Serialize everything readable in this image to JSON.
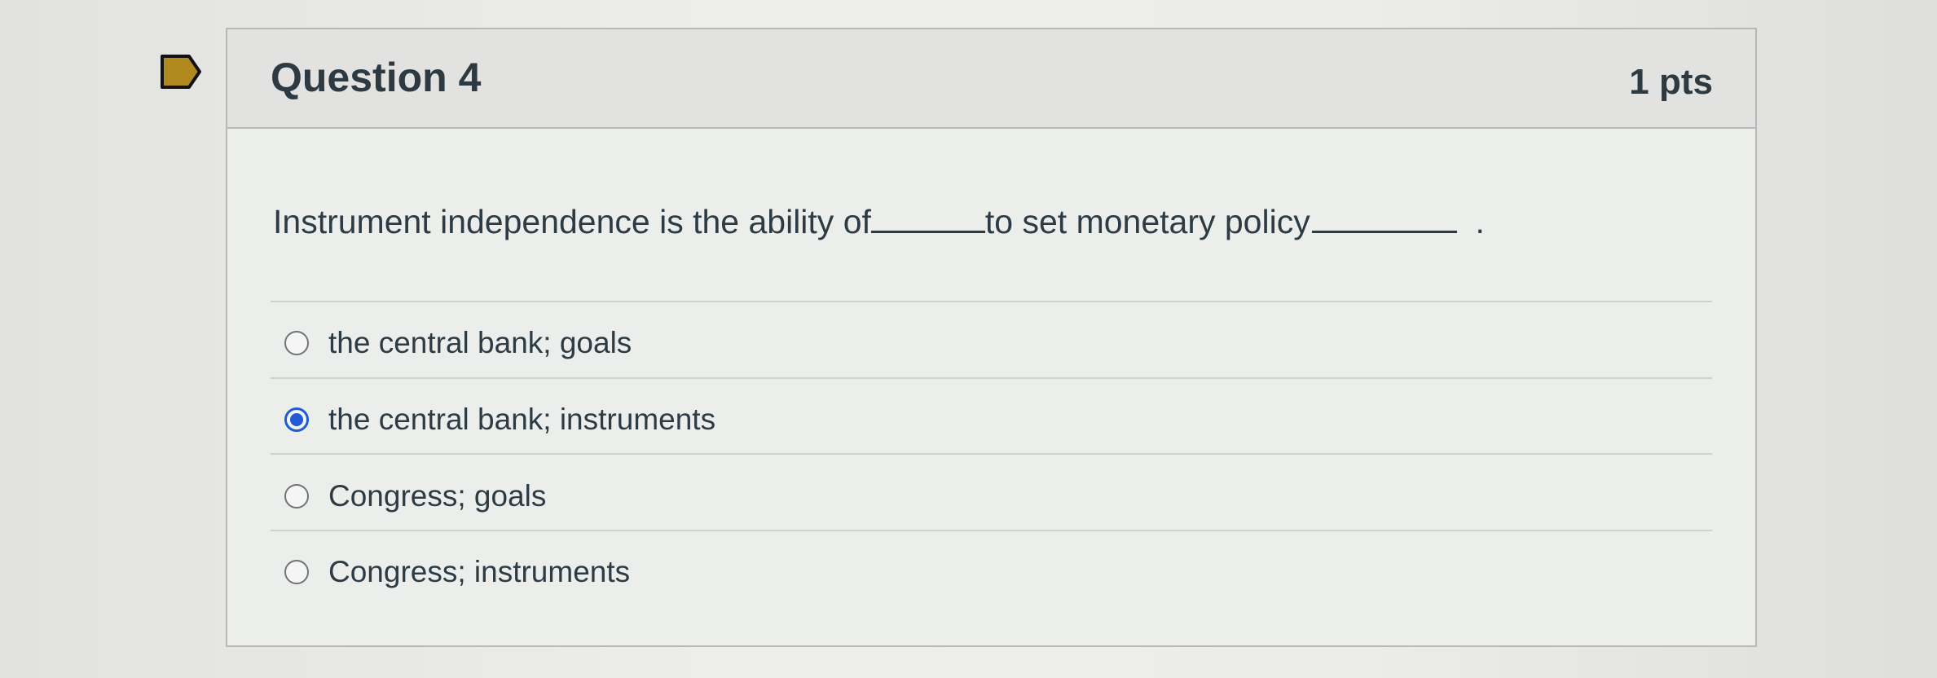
{
  "question": {
    "title": "Question 4",
    "points": "1 pts",
    "text_part1": "Instrument independence is the ability of",
    "text_part2": "to set monetary policy",
    "text_end": "."
  },
  "answers": [
    {
      "label": "the central bank; goals",
      "selected": false
    },
    {
      "label": "the central bank; instruments",
      "selected": true
    },
    {
      "label": "Congress; goals",
      "selected": false
    },
    {
      "label": "Congress; instruments",
      "selected": false
    }
  ],
  "colors": {
    "flag": "#b08a1e",
    "radio_selected": "#1f5bd6"
  }
}
